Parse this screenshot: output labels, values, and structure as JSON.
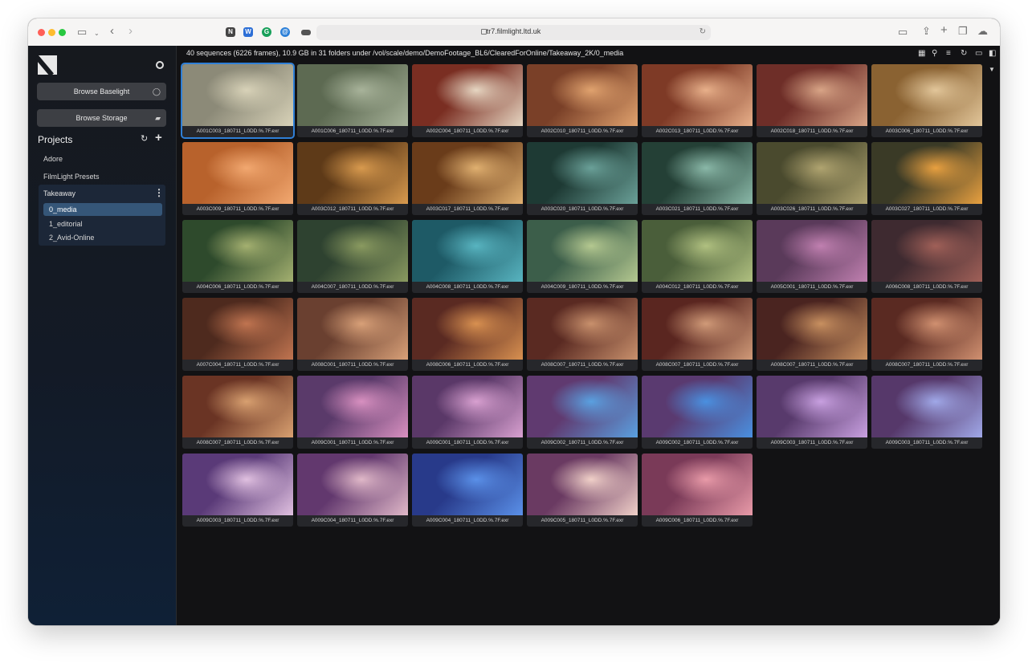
{
  "browser": {
    "url": "tr7.filmlight.ltd.uk"
  },
  "sidebar": {
    "browse_baselight": "Browse Baselight",
    "browse_storage": "Browse Storage",
    "projects_title": "Projects",
    "projects": [
      {
        "label": "Adore"
      },
      {
        "label": "FilmLight Presets"
      },
      {
        "label": "Takeaway"
      }
    ],
    "takeaway_children": [
      {
        "label": "0_media",
        "active": true
      },
      {
        "label": "1_editorial",
        "active": false
      },
      {
        "label": "2_Avid-Online",
        "active": false
      }
    ]
  },
  "main": {
    "info": "40 sequences (6226 frames), 10.9 GB in 31 folders under /vol/scale/demo/DemoFootage_BL6/ClearedForOnline/Takeaway_2K/0_media",
    "clips": [
      {
        "name": "A001C003_180711_L0DD.%.7F.exr",
        "color": "#8c8a78",
        "accent": "#d8d2b8",
        "selected": true
      },
      {
        "name": "A001C006_180711_L0DD.%.7F.exr",
        "color": "#5d6a52",
        "accent": "#a8b39a"
      },
      {
        "name": "A002C004_180711_L0DD.%.7F.exr",
        "color": "#7a2e22",
        "accent": "#e6d6c2"
      },
      {
        "name": "A002C010_180711_L0DD.%.7F.exr",
        "color": "#7a4028",
        "accent": "#e0a26e"
      },
      {
        "name": "A002C013_180711_L0DD.%.7F.exr",
        "color": "#7e3a26",
        "accent": "#e8b08a"
      },
      {
        "name": "A002C018_180711_L0DD.%.7F.exr",
        "color": "#6e2e28",
        "accent": "#d8a486"
      },
      {
        "name": "A003C006_180711_L0DD.%.7F.exr",
        "color": "#8a6232",
        "accent": "#e2c69a"
      },
      {
        "name": "A003C009_180711_L0DD.%.7F.exr",
        "color": "#b8622c",
        "accent": "#f2a870"
      },
      {
        "name": "A003C012_180711_L0DD.%.7F.exr",
        "color": "#5e3a18",
        "accent": "#d89a4e"
      },
      {
        "name": "A003C017_180711_L0DD.%.7F.exr",
        "color": "#6a3c1a",
        "accent": "#e0b070"
      },
      {
        "name": "A003C020_180711_L0DD.%.7F.exr",
        "color": "#1e3a34",
        "accent": "#6aa098"
      },
      {
        "name": "A003C021_180711_L0DD.%.7F.exr",
        "color": "#244036",
        "accent": "#8ab8a8"
      },
      {
        "name": "A003C026_180711_L0DD.%.7F.exr",
        "color": "#4a4a2e",
        "accent": "#b0a470"
      },
      {
        "name": "A003C027_180711_L0DD.%.7F.exr",
        "color": "#3a3a26",
        "accent": "#e8a040"
      },
      {
        "name": "A004C006_180711_L0DD.%.7F.exr",
        "color": "#2e4a2c",
        "accent": "#a4b070"
      },
      {
        "name": "A004C007_180711_L0DD.%.7F.exr",
        "color": "#2e4230",
        "accent": "#8a9a60"
      },
      {
        "name": "A004C008_180711_L0DD.%.7F.exr",
        "color": "#1e5a66",
        "accent": "#58b4c0"
      },
      {
        "name": "A004C009_180711_L0DD.%.7F.exr",
        "color": "#3c5e4a",
        "accent": "#b4c890"
      },
      {
        "name": "A004C012_180711_L0DD.%.7F.exr",
        "color": "#4a5e3a",
        "accent": "#b0c080"
      },
      {
        "name": "A005C001_180711_L0DD.%.7F.exr",
        "color": "#5a3a5a",
        "accent": "#c080b0"
      },
      {
        "name": "A006C008_180711_L0DD.%.7F.exr",
        "color": "#3e2a30",
        "accent": "#a06058"
      },
      {
        "name": "A007C004_180711_L0DD.%.7F.exr",
        "color": "#4e2a1e",
        "accent": "#c07450"
      },
      {
        "name": "A008C001_180711_L0DD.%.7F.exr",
        "color": "#6a4030",
        "accent": "#d8a078"
      },
      {
        "name": "A008C006_180711_L0DD.%.7F.exr",
        "color": "#5a2a22",
        "accent": "#d89050"
      },
      {
        "name": "A008C007_180711_L0DD.%.7F.exr",
        "color": "#5a2a22",
        "accent": "#c8906c"
      },
      {
        "name": "A008C007_180711_L0DD.%.7F.exr",
        "color": "#5a2620",
        "accent": "#d09a78"
      },
      {
        "name": "A008C007_180711_L0DD.%.7F.exr",
        "color": "#4a2420",
        "accent": "#c89060"
      },
      {
        "name": "A008C007_180711_L0DD.%.7F.exr",
        "color": "#5a2a22",
        "accent": "#d09070"
      },
      {
        "name": "A008C007_180711_L0DD.%.7F.exr",
        "color": "#6a3424",
        "accent": "#d8a070"
      },
      {
        "name": "A009C001_180711_L0DD.%.7F.exr",
        "color": "#5a3a6a",
        "accent": "#d890c0"
      },
      {
        "name": "A009C001_180711_L0DD.%.7F.exr",
        "color": "#5a3868",
        "accent": "#d8a0d0"
      },
      {
        "name": "A009C002_180711_L0DD.%.7F.exr",
        "color": "#603a70",
        "accent": "#5aa0e0"
      },
      {
        "name": "A009C002_180711_L0DD.%.7F.exr",
        "color": "#5a3a70",
        "accent": "#4a90e0"
      },
      {
        "name": "A009C003_180711_L0DD.%.7F.exr",
        "color": "#583a6c",
        "accent": "#c8a0e0"
      },
      {
        "name": "A009C003_180711_L0DD.%.7F.exr",
        "color": "#56386a",
        "accent": "#a0a8e8"
      },
      {
        "name": "A009C003_180711_L0DD.%.7F.exr",
        "color": "#5a3a78",
        "accent": "#e0c0e0"
      },
      {
        "name": "A009C004_180711_L0DD.%.7F.exr",
        "color": "#62386e",
        "accent": "#e0b8c8"
      },
      {
        "name": "A009C004_180711_L0DD.%.7F.exr",
        "color": "#283a8a",
        "accent": "#5a90e8"
      },
      {
        "name": "A009C005_180711_L0DD.%.7F.exr",
        "color": "#6a3a62",
        "accent": "#f0d0c8"
      },
      {
        "name": "A009C006_180711_L0DD.%.7F.exr",
        "color": "#7a3a58",
        "accent": "#e89aa8"
      }
    ]
  }
}
